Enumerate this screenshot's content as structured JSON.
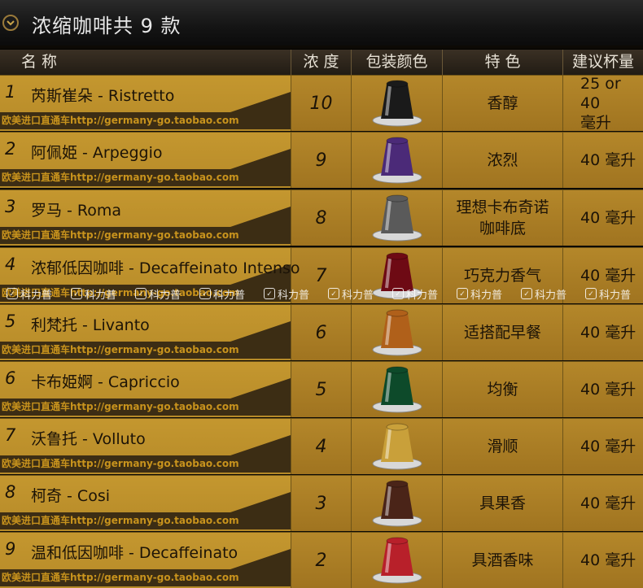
{
  "page": {
    "title": "浓缩咖啡共 9 款",
    "url_watermark": "欧美进口直通车http://germany-go.taobao.com",
    "brand_watermark": "科力普"
  },
  "header": {
    "name": "名   称",
    "strength": "浓 度",
    "color": "包装颜色",
    "feature": "特   色",
    "cup": "建议杯量"
  },
  "coffees": [
    {
      "num": "1",
      "name": "芮斯崔朵 - Ristretto",
      "strength": "10",
      "color": "#1a1a1a",
      "feature": "香醇",
      "cup": "25 or 40\n毫升"
    },
    {
      "num": "2",
      "name": "阿佩姫 - Arpeggio",
      "strength": "9",
      "color": "#4b2a78",
      "feature": "浓烈",
      "cup": "40 毫升"
    },
    {
      "num": "3",
      "name": "罗马 - Roma",
      "strength": "8",
      "color": "#5a5a5a",
      "feature": "理想卡布奇诺\n咖啡底",
      "cup": "40 毫升"
    },
    {
      "num": "4",
      "name": "浓郁低因咖啡 - Decaffeinato Intenso",
      "strength": "7",
      "color": "#6e0a14",
      "feature": "巧克力香气",
      "cup": "40 毫升"
    },
    {
      "num": "5",
      "name": "利梵托 - Livanto",
      "strength": "6",
      "color": "#b0601a",
      "feature": "适搭配早餐",
      "cup": "40 毫升"
    },
    {
      "num": "6",
      "name": "卡布姫婀 -  Capriccio",
      "strength": "5",
      "color": "#0d4a2a",
      "feature": "均衡",
      "cup": "40 毫升"
    },
    {
      "num": "7",
      "name": "沃鲁托 -  Volluto",
      "strength": "4",
      "color": "#c9a03a",
      "feature": "滑顺",
      "cup": "40 毫升"
    },
    {
      "num": "8",
      "name": "柯奇 - Cosi",
      "strength": "3",
      "color": "#4a2418",
      "feature": "具果香",
      "cup": "40 毫升"
    },
    {
      "num": "9",
      "name": "温和低因咖啡 -  Decaffeinato",
      "strength": "2",
      "color": "#b8202a",
      "feature": "具酒香味",
      "cup": "40 毫升"
    }
  ]
}
